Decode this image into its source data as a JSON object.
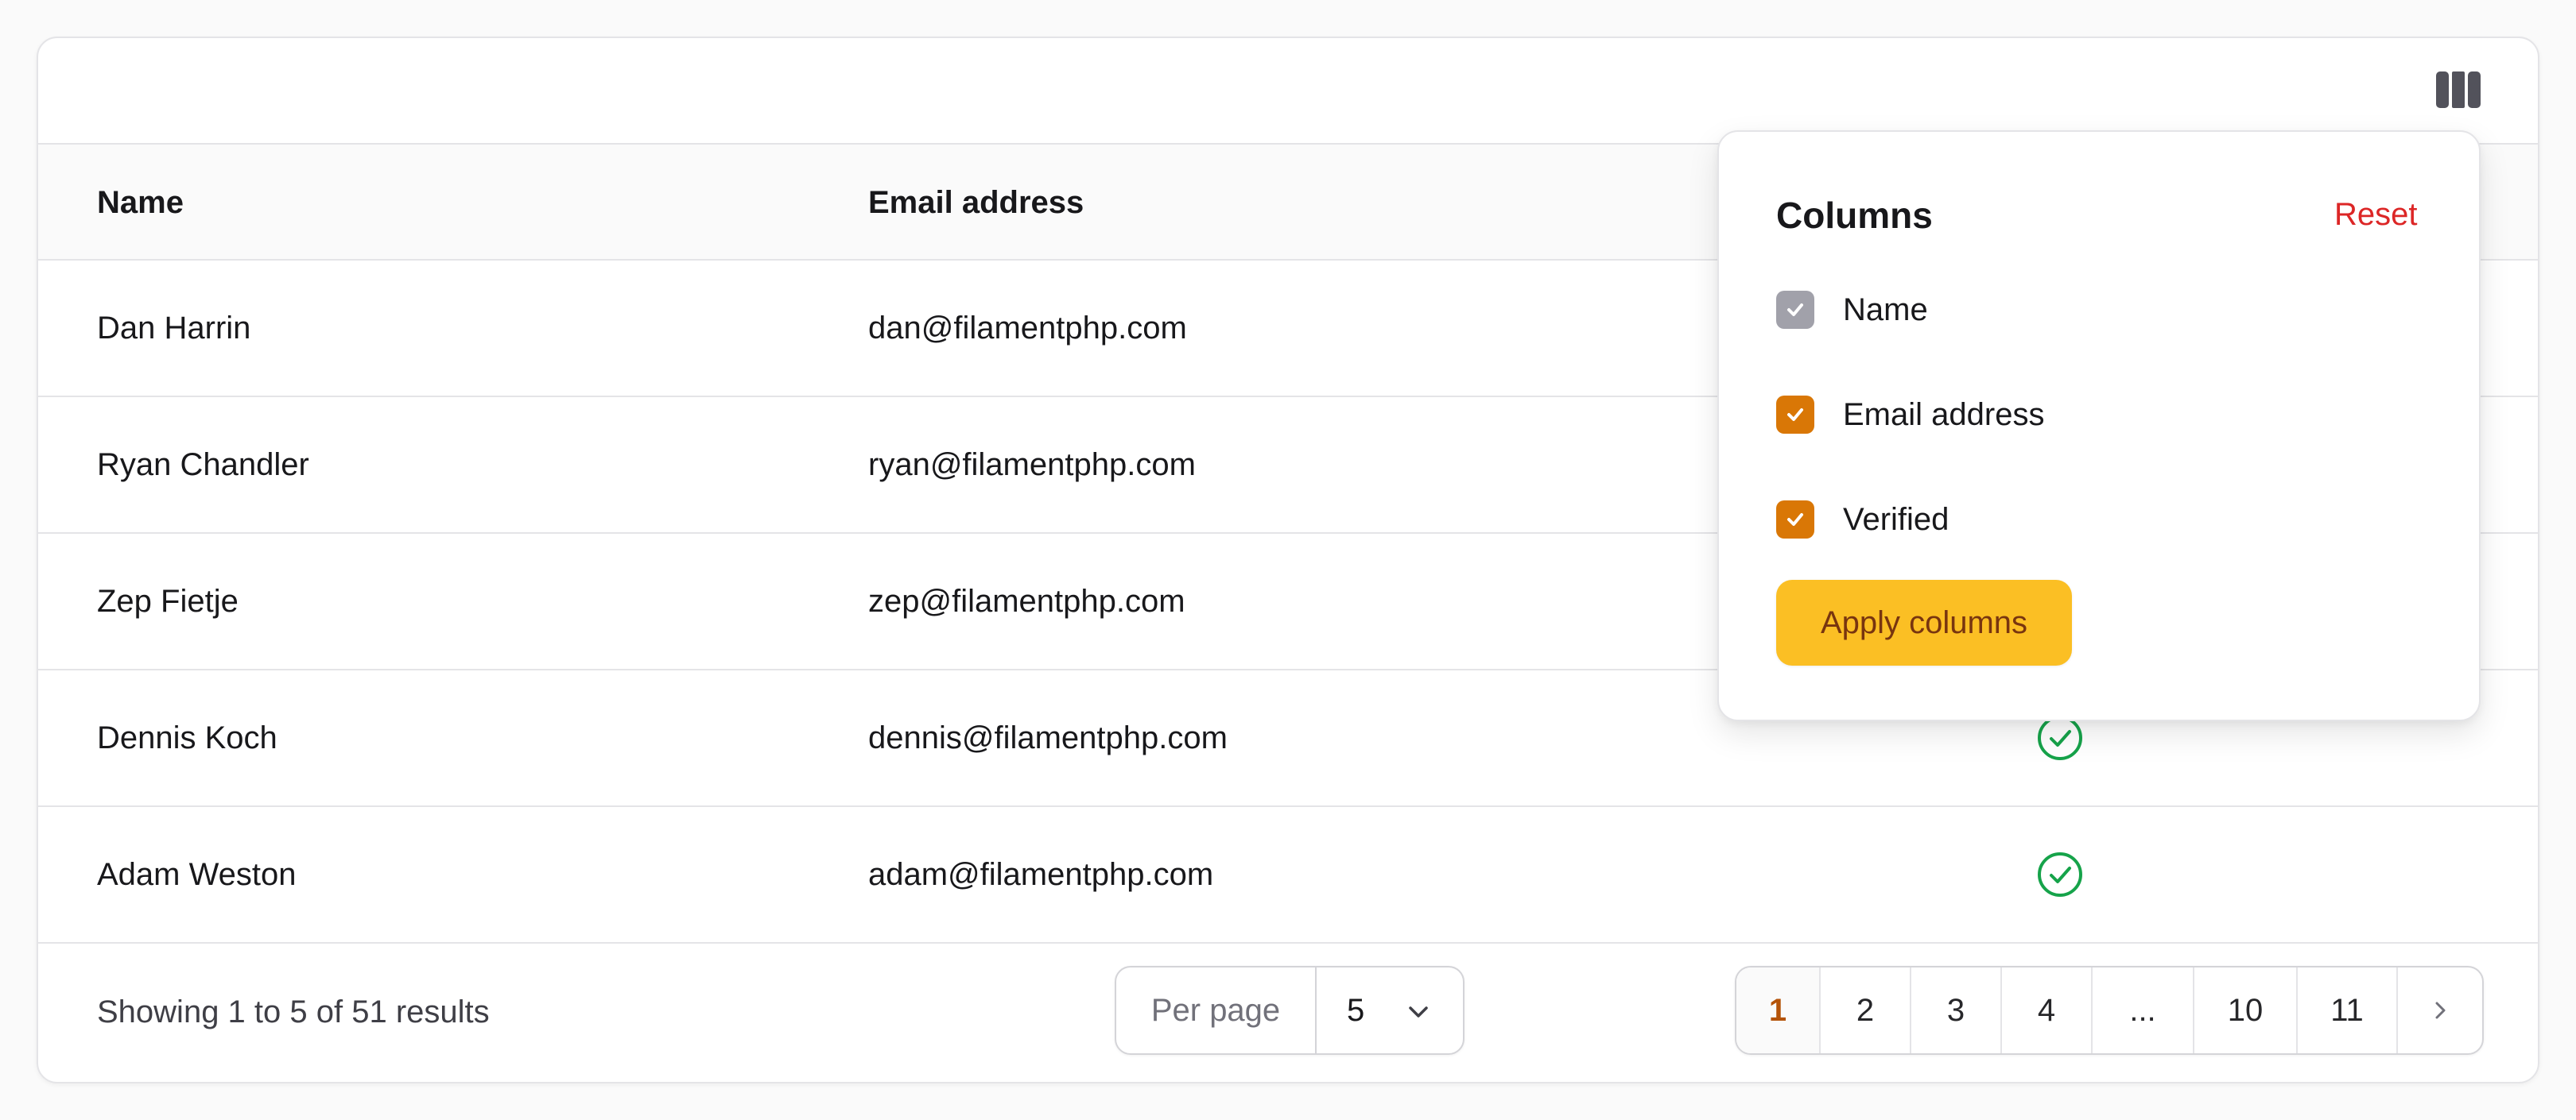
{
  "table": {
    "columns": [
      {
        "label": "Name"
      },
      {
        "label": "Email address"
      }
    ],
    "rows": [
      {
        "name": "Dan Harrin",
        "email": "dan@filamentphp.com",
        "verified": true
      },
      {
        "name": "Ryan Chandler",
        "email": "ryan@filamentphp.com",
        "verified": true
      },
      {
        "name": "Zep Fietje",
        "email": "zep@filamentphp.com",
        "verified": true
      },
      {
        "name": "Dennis Koch",
        "email": "dennis@filamentphp.com",
        "verified": true
      },
      {
        "name": "Adam Weston",
        "email": "adam@filamentphp.com",
        "verified": true
      }
    ]
  },
  "toolbar": {
    "column_toggle_icon": "columns-icon"
  },
  "footer": {
    "showing": "Showing 1 to 5 of 51 results",
    "per_page_label": "Per page",
    "per_page_value": "5",
    "pages": [
      "1",
      "2",
      "3",
      "4",
      "...",
      "10",
      "11"
    ],
    "current_page": "1"
  },
  "columns_popover": {
    "title": "Columns",
    "reset_label": "Reset",
    "options": [
      {
        "label": "Name",
        "checked": true,
        "disabled": true
      },
      {
        "label": "Email address",
        "checked": true,
        "disabled": false
      },
      {
        "label": "Verified",
        "checked": true,
        "disabled": false
      }
    ],
    "apply_label": "Apply columns"
  },
  "colors": {
    "accent": "#d97706",
    "apply_button": "#fbbf24",
    "reset": "#dc2626",
    "verified": "#16a34a",
    "current_page": "#b45309"
  }
}
